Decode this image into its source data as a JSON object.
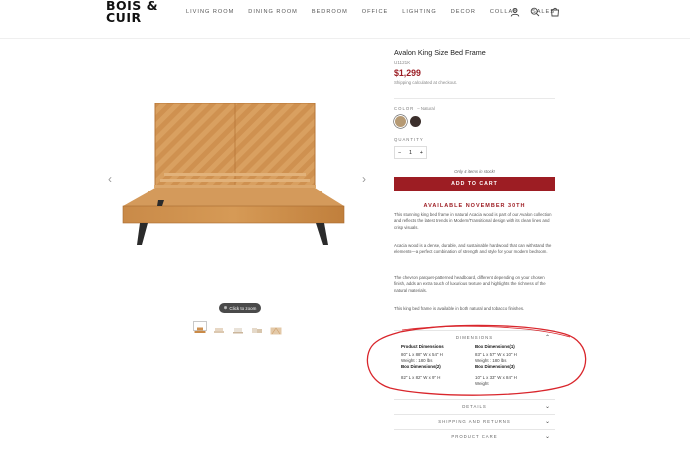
{
  "header": {
    "logo_line1": "BOIS &",
    "logo_line2": "CUIR",
    "nav": [
      "LIVING ROOM",
      "DINING ROOM",
      "BEDROOM",
      "OFFICE",
      "LIGHTING",
      "DECOR",
      "COLLAB",
      "SALES"
    ]
  },
  "gallery": {
    "zoom_label": "Click to zoom",
    "thumb_count": 5
  },
  "product": {
    "title": "Avalon King Size Bed Frame",
    "sku": "U1121K",
    "price": "$1,299",
    "shipping_note": "Shipping calculated at checkout.",
    "color_label": "COLOR",
    "color_value": "– Natural",
    "swatches": [
      "#b69a74",
      "#3b2f2c"
    ],
    "quantity_label": "QUANTITY",
    "quantity_value": "1",
    "qty_minus": "−",
    "qty_plus": "+",
    "stock_note": "Only 4 items in stock!",
    "add_to_cart": "ADD TO CART",
    "availability": "AVAILABLE NOVEMBER 30TH",
    "description": [
      "This stunning king bed frame in natural Acacia wood is part of our Avalon collection and reflects the latest trends in Modern/Transitional design with its clean lines and crisp visuals.",
      "Acacia wood is a dense, durable, and sustainable hardwood that can withstand the elements—a perfect combination of strength and style for your modern bedroom.",
      "The chevron parquet-patterned headboard, different depending on your chosen finish, adds an extra touch of luxurious texture and highlights the richness of the natural materials.",
      "This king bed frame is available in both natural and tobacco finishes."
    ]
  },
  "dimensions": {
    "heading": "DIMENSIONS",
    "product_dims_label": "Product Dimensions",
    "product_dims_value": "80\" L x 88\" W x 54\" H",
    "product_weight": "Weight : 180 lbs",
    "box1_label": "Box Dimensions(1)",
    "box1_value": "83\" L x 57\" W x 10\" H",
    "box1_weight": "Weight : 180 lbs",
    "box2_label": "Box Dimensions(2)",
    "box2_value": "82\" L x 82\" W x 9\" H",
    "box3_label": "Box Dimensions(3)",
    "box3_value": "10\" L x 33\" W x 84\" H",
    "box3_weight": "Weight"
  },
  "accordion": {
    "details": "DETAILS",
    "shipping": "SHIPPING AND RETURNS",
    "care": "PRODUCT CARE"
  },
  "annotation_color": "#d9262c"
}
